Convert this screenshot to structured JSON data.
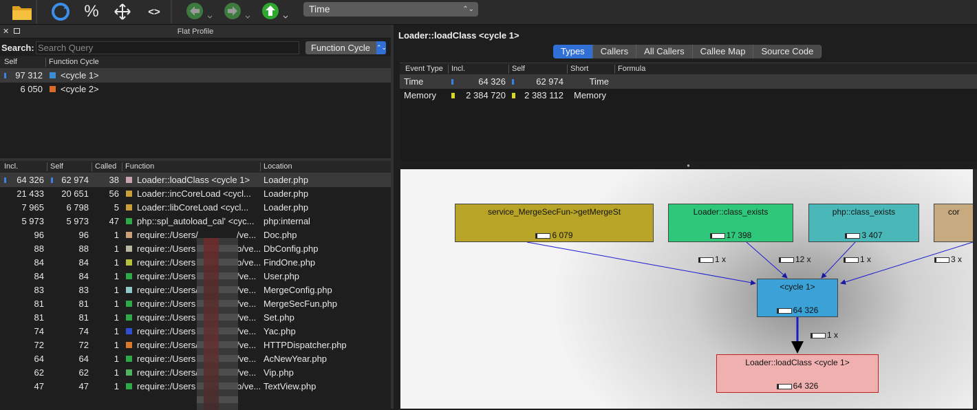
{
  "toolbar": {
    "event_select": "Time"
  },
  "flat_profile": {
    "title": "Flat Profile",
    "search_label": "Search:",
    "search_placeholder": "Search Query",
    "group_select": "Function Cycle",
    "cycle_headers": [
      "Self",
      "Function Cycle"
    ],
    "cycles": [
      {
        "self": "97 312",
        "name": "<cycle 1>",
        "color": "#3b8ed6"
      },
      {
        "self": "6 050",
        "name": "<cycle 2>",
        "color": "#d86a2a"
      }
    ],
    "headers": [
      "Incl.",
      "Self",
      "Called",
      "Function",
      "Location"
    ],
    "rows": [
      {
        "incl": "64 326",
        "self": "62 974",
        "called": "38",
        "func": "Loader::loadClass <cycle 1>",
        "loc": "Loader.php",
        "color": "#c9a3b0"
      },
      {
        "incl": "21 433",
        "self": "20 651",
        "called": "56",
        "func": "Loader::incCoreLoad <cycl...",
        "loc": "Loader.php",
        "color": "#c9a03a"
      },
      {
        "incl": "7 965",
        "self": "6 798",
        "called": "5",
        "func": "Loader::libCoreLoad <cycl...",
        "loc": "Loader.php",
        "color": "#c9a03a"
      },
      {
        "incl": "5 973",
        "self": "5 973",
        "called": "47",
        "func": "php::spl_autoload_cal' <cyc...",
        "loc": "php:internal",
        "color": "#2fa84a"
      },
      {
        "incl": "96",
        "self": "96",
        "called": "1",
        "func": "require::/Users/",
        "func2": "/ve...",
        "loc": "Doc.php",
        "color": "#c9a07a"
      },
      {
        "incl": "88",
        "self": "88",
        "called": "1",
        "func": "require::/Users",
        "func2": "b/ve...",
        "loc": "DbConfig.php",
        "color": "#b8b8a0"
      },
      {
        "incl": "84",
        "self": "84",
        "called": "1",
        "func": "require::/Users",
        "func2": "b/ve...",
        "loc": "FindOne.php",
        "color": "#b8c040"
      },
      {
        "incl": "84",
        "self": "84",
        "called": "1",
        "func": "require::/Users",
        "func2": "/ve...",
        "loc": "User.php",
        "color": "#2fa84a"
      },
      {
        "incl": "83",
        "self": "83",
        "called": "1",
        "func": "require::/Users/",
        "func2": "/ve...",
        "loc": "MergeConfig.php",
        "color": "#8ec8c8"
      },
      {
        "incl": "81",
        "self": "81",
        "called": "1",
        "func": "require::/Users",
        "func2": "/ve...",
        "loc": "MergeSecFun.php",
        "color": "#2fa84a"
      },
      {
        "incl": "81",
        "self": "81",
        "called": "1",
        "func": "require::/Users",
        "func2": "/ve...",
        "loc": "Set.php",
        "color": "#2fa84a"
      },
      {
        "incl": "74",
        "self": "74",
        "called": "1",
        "func": "require::/Users",
        "func2": "/ve...",
        "loc": "Yac.php",
        "color": "#2f4fd0"
      },
      {
        "incl": "72",
        "self": "72",
        "called": "1",
        "func": "require::/Users/",
        "func2": "/ve...",
        "loc": "HTTPDispatcher.php",
        "color": "#d87a2a"
      },
      {
        "incl": "64",
        "self": "64",
        "called": "1",
        "func": "require::/Users",
        "func2": "/ve...",
        "loc": "AcNewYear.php",
        "color": "#2fa84a"
      },
      {
        "incl": "62",
        "self": "62",
        "called": "1",
        "func": "require::/Users/",
        "func2": "/ve...",
        "loc": "Vip.php",
        "color": "#4fb060"
      },
      {
        "incl": "47",
        "self": "47",
        "called": "1",
        "func": "require::/Users",
        "func2": "b/ve...",
        "loc": "TextView.php",
        "color": "#2fa84a"
      }
    ]
  },
  "detail": {
    "title": "Loader::loadClass <cycle 1>",
    "tabs": [
      "Types",
      "Callers",
      "All Callers",
      "Callee Map",
      "Source Code"
    ],
    "event_headers": [
      "Event Type",
      "Incl.",
      "Self",
      "Short",
      "Formula"
    ],
    "events": [
      {
        "type": "Time",
        "incl": "64 326",
        "self": "62 974",
        "short": "Time",
        "color": "#3b84e6"
      },
      {
        "type": "Memory",
        "incl": "2 384 720",
        "self": "2 383 112",
        "short": "Memory",
        "color": "#d8d820"
      }
    ]
  },
  "graph": {
    "nodes": [
      {
        "label": "service_MergeSecFun->getMergeSt",
        "value": "6 079",
        "color": "#b8a426"
      },
      {
        "label": "Loader::class_exists",
        "value": "17 398",
        "color": "#2fc87a"
      },
      {
        "label": "php::class_exists",
        "value": "3 407",
        "color": "#4ab8b8"
      },
      {
        "label": "cor",
        "value": "",
        "color": "#c8aa80"
      },
      {
        "label": "<cycle 1>",
        "value": "64 326",
        "color": "#3aa2d6"
      },
      {
        "label": "Loader::loadClass <cycle 1>",
        "value": "64 326",
        "color": "#f0b0b0"
      }
    ],
    "edges": [
      "1 x",
      "12 x",
      "1 x",
      "3 x",
      "1 x"
    ]
  }
}
